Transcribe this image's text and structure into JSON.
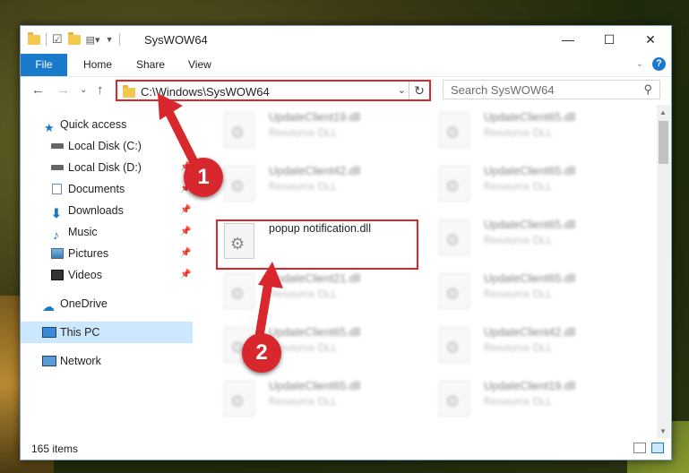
{
  "window": {
    "title": "SysWOW64",
    "controls": {
      "minimize": "—",
      "maximize": "☐",
      "close": "✕"
    }
  },
  "ribbon": {
    "tabs": [
      {
        "label": "File",
        "active": true
      },
      {
        "label": "Home"
      },
      {
        "label": "Share"
      },
      {
        "label": "View"
      }
    ],
    "accent_color": "#1979ca"
  },
  "navigation": {
    "address": "C:\\Windows\\SysWOW64",
    "search_placeholder": "Search SysWOW64"
  },
  "sidebar": {
    "items": [
      {
        "label": "Quick access",
        "icon": "star-icon"
      },
      {
        "label": "Local Disk (C:)",
        "icon": "drive-icon"
      },
      {
        "label": "Local Disk (D:)",
        "icon": "drive-icon"
      },
      {
        "label": "Documents",
        "icon": "documents-icon"
      },
      {
        "label": "Downloads",
        "icon": "download-icon"
      },
      {
        "label": "Music",
        "icon": "music-icon"
      },
      {
        "label": "Pictures",
        "icon": "pictures-icon"
      },
      {
        "label": "Videos",
        "icon": "videos-icon"
      },
      {
        "label": "OneDrive",
        "icon": "cloud-icon"
      },
      {
        "label": "This PC",
        "icon": "computer-icon",
        "selected": true
      },
      {
        "label": "Network",
        "icon": "network-icon"
      }
    ]
  },
  "files": {
    "left_column": [
      {
        "name": "UpdateClient19.dll",
        "type": "Resource DLL"
      },
      {
        "name": "UpdateClient42.dll",
        "type": "Resource DLL"
      },
      {
        "name": "popup notification.dll",
        "type": ""
      },
      {
        "name": "UpdateClient21.dll",
        "type": "Resource DLL"
      },
      {
        "name": "UpdateClient65.dll",
        "type": "Resource DLL"
      },
      {
        "name": "UpdateClient65.dll",
        "type": "Resource DLL"
      }
    ],
    "right_column": [
      {
        "name": "UpdateClient65.dll",
        "type": "Resource DLL"
      },
      {
        "name": "UpdateClient65.dll",
        "type": "Resource DLL"
      },
      {
        "name": "UpdateClient65.dll",
        "type": "Resource DLL"
      },
      {
        "name": "UpdateClient65.dll",
        "type": "Resource DLL"
      },
      {
        "name": "UpdateClient42.dll",
        "type": "Resource DLL"
      },
      {
        "name": "UpdateClient19.dll",
        "type": "Resource DLL"
      }
    ]
  },
  "status": {
    "item_count": "165 items"
  },
  "annotations": {
    "step1": "1",
    "step2": "2",
    "color": "#d9272e"
  }
}
